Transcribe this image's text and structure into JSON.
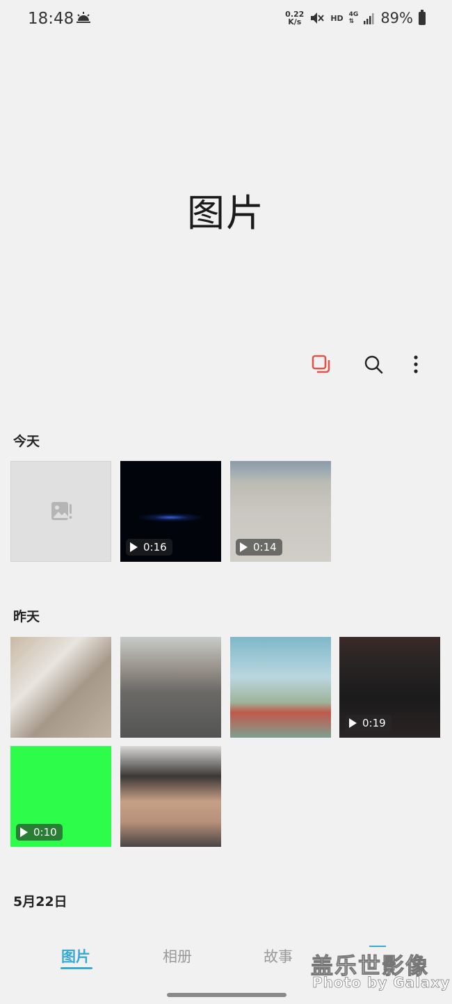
{
  "status_bar": {
    "time": "18:48",
    "speed_value": "0.22",
    "speed_unit": "K/s",
    "hd": "HD",
    "network": "4G",
    "battery": "89%"
  },
  "page": {
    "title": "图片"
  },
  "sections": [
    {
      "label": "今天",
      "items": [
        {
          "type": "broken-image"
        },
        {
          "type": "video",
          "duration": "0:16"
        },
        {
          "type": "video",
          "duration": "0:14"
        }
      ]
    },
    {
      "label": "昨天",
      "items": [
        {
          "type": "photo"
        },
        {
          "type": "photo"
        },
        {
          "type": "photo"
        },
        {
          "type": "video",
          "duration": "0:19"
        },
        {
          "type": "video",
          "duration": "0:10"
        },
        {
          "type": "photo"
        }
      ]
    },
    {
      "label": "5月22日",
      "items": []
    }
  ],
  "tabs": [
    {
      "label": "图片",
      "active": true
    },
    {
      "label": "相册",
      "active": false
    },
    {
      "label": "故事",
      "active": false
    }
  ],
  "watermark": {
    "line1": "盖乐世影像",
    "line2": "Photo by Galaxy"
  },
  "colors": {
    "accent": "#36a8d8",
    "select_icon": "#e2534a",
    "green_thumb": "#2efc4a"
  }
}
